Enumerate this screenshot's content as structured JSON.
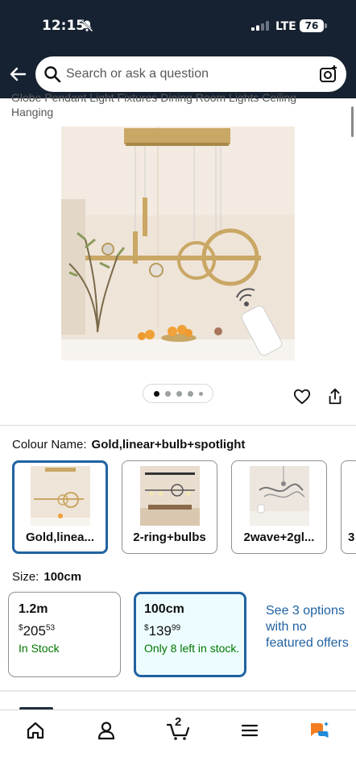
{
  "status_bar": {
    "time": "12:15",
    "network": "LTE",
    "battery": "76"
  },
  "search": {
    "placeholder": "Search or ask a question"
  },
  "product": {
    "title": "Globe Pendant Light Fixtures Dining Room Lights Ceiling Hanging"
  },
  "carousel": {
    "dot_count": 5,
    "active_index": 0
  },
  "colour": {
    "label": "Colour Name:",
    "selected": "Gold,linear+bulb+spotlight",
    "options": [
      {
        "label": "Gold,linea..."
      },
      {
        "label": "2-ring+bulbs"
      },
      {
        "label": "2wave+2gl..."
      },
      {
        "label": "3"
      }
    ]
  },
  "size": {
    "label": "Size:",
    "selected": "100cm",
    "options": [
      {
        "size": "1.2m",
        "price_whole": "205",
        "price_cents": "53",
        "currency": "$",
        "stock": "In Stock"
      },
      {
        "size": "100cm",
        "price_whole": "139",
        "price_cents": "99",
        "currency": "$",
        "stock": "Only 8 left in stock."
      }
    ],
    "see_more": "See 3 options with no featured offers"
  },
  "nav": {
    "cart_count": "2"
  },
  "colors": {
    "header_bg": "#162231",
    "selected_border": "#2162a1",
    "link": "#2162a1",
    "stock_green": "#007600"
  }
}
